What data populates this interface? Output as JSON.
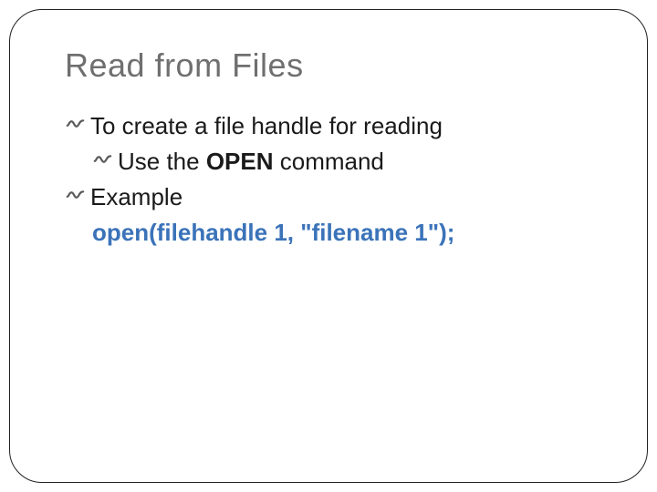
{
  "title": "Read from Files",
  "lines": {
    "l1_pre": "To create a file handle for reading",
    "l2_pre": "Use the ",
    "l2_kw": "OPEN",
    "l2_post": " command",
    "l3": "Example",
    "code": "open(filehandle 1, \"filename 1\");"
  }
}
